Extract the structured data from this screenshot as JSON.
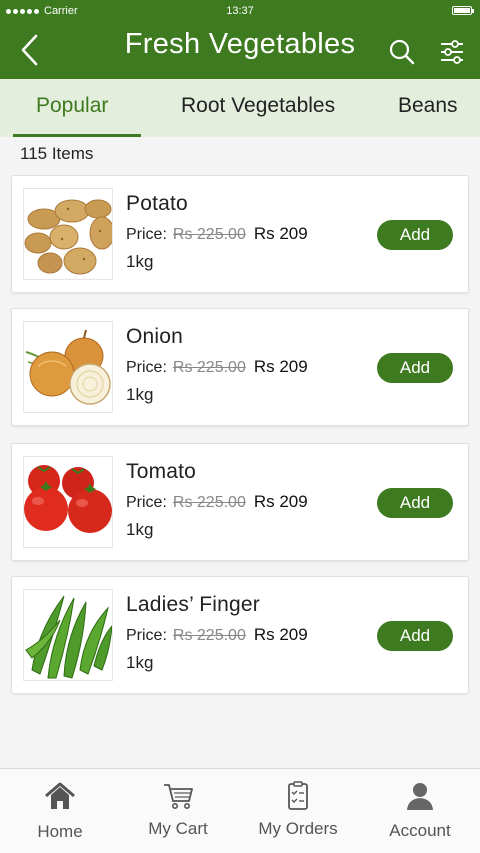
{
  "status_bar": {
    "carrier": "Carrier",
    "time": "13:37"
  },
  "header": {
    "title": "Fresh Vegetables"
  },
  "tabs": [
    {
      "label": "Popular",
      "active": true
    },
    {
      "label": "Root Vegetables",
      "active": false
    },
    {
      "label": "Beans",
      "active": false
    }
  ],
  "items_count": "115 Items",
  "products": [
    {
      "name": "Potato",
      "price_label": "Price:",
      "old_price": "Rs 225.00",
      "new_price": "Rs 209",
      "quantity": "1kg",
      "add_label": "Add",
      "image_icon": "potato-image"
    },
    {
      "name": "Onion",
      "price_label": "Price:",
      "old_price": "Rs 225.00",
      "new_price": "Rs 209",
      "quantity": "1kg",
      "add_label": "Add",
      "image_icon": "onion-image"
    },
    {
      "name": "Tomato",
      "price_label": "Price:",
      "old_price": "Rs 225.00",
      "new_price": "Rs 209",
      "quantity": "1kg",
      "add_label": "Add",
      "image_icon": "tomato-image"
    },
    {
      "name": "Ladies’ Finger",
      "price_label": "Price:",
      "old_price": "Rs 225.00",
      "new_price": "Rs 209",
      "quantity": "1kg",
      "add_label": "Add",
      "image_icon": "okra-image"
    }
  ],
  "bottom_nav": [
    {
      "label": "Home",
      "icon": "home-icon"
    },
    {
      "label": "My Cart",
      "icon": "cart-icon"
    },
    {
      "label": "My Orders",
      "icon": "orders-icon"
    },
    {
      "label": "Account",
      "icon": "account-icon"
    }
  ],
  "colors": {
    "primary": "#3e7a1f",
    "tab_background": "#e3eedd",
    "background": "#f4f4f4"
  }
}
